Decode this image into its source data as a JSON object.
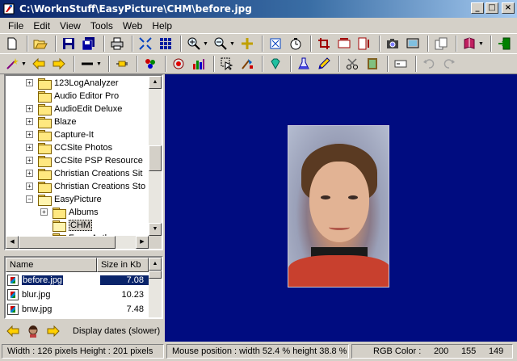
{
  "window": {
    "title": "C:\\WorknStuff\\EasyPicture\\CHM\\before.jpg",
    "minimize": "_",
    "maximize": "□",
    "close": "×"
  },
  "menu": [
    "File",
    "Edit",
    "View",
    "Tools",
    "Web",
    "Help"
  ],
  "tree": {
    "items": [
      {
        "label": "123LogAnalyzer",
        "expander": "+"
      },
      {
        "label": "Audio Editor Pro",
        "expander": ""
      },
      {
        "label": "AudioEdit Deluxe",
        "expander": "+"
      },
      {
        "label": "Blaze",
        "expander": "+"
      },
      {
        "label": "Capture-It",
        "expander": "+"
      },
      {
        "label": "CCSite Photos",
        "expander": "+"
      },
      {
        "label": "CCSite PSP Resource",
        "expander": "+"
      },
      {
        "label": "Christian Creations Sit",
        "expander": "+"
      },
      {
        "label": "Christian Creations Sto",
        "expander": "+"
      },
      {
        "label": "EasyPicture",
        "expander": "−"
      },
      {
        "label": "Albums",
        "expander": "+"
      },
      {
        "label": "CHM",
        "expander": ""
      },
      {
        "label": "From Author",
        "expander": ""
      }
    ]
  },
  "file_list": {
    "columns": {
      "name": "Name",
      "size": "Size in Kb"
    },
    "rows": [
      {
        "name": "before.jpg",
        "size": "7.08"
      },
      {
        "name": "blur.jpg",
        "size": "10.23"
      },
      {
        "name": "bnw.jpg",
        "size": "7.48"
      }
    ]
  },
  "nav": {
    "display_dates": "Display dates (slower)"
  },
  "status": {
    "dimensions": "Width : 126 pixels  Height : 201 pixels",
    "mouse": "Mouse position : width 52.4 %  height 38.8 %",
    "rgb_label": "RGB Color :",
    "rgb_r": "200",
    "rgb_g": "155",
    "rgb_b": "149"
  },
  "colors": {
    "viewer_bg": "#000c80",
    "selection": "#0a246a"
  }
}
